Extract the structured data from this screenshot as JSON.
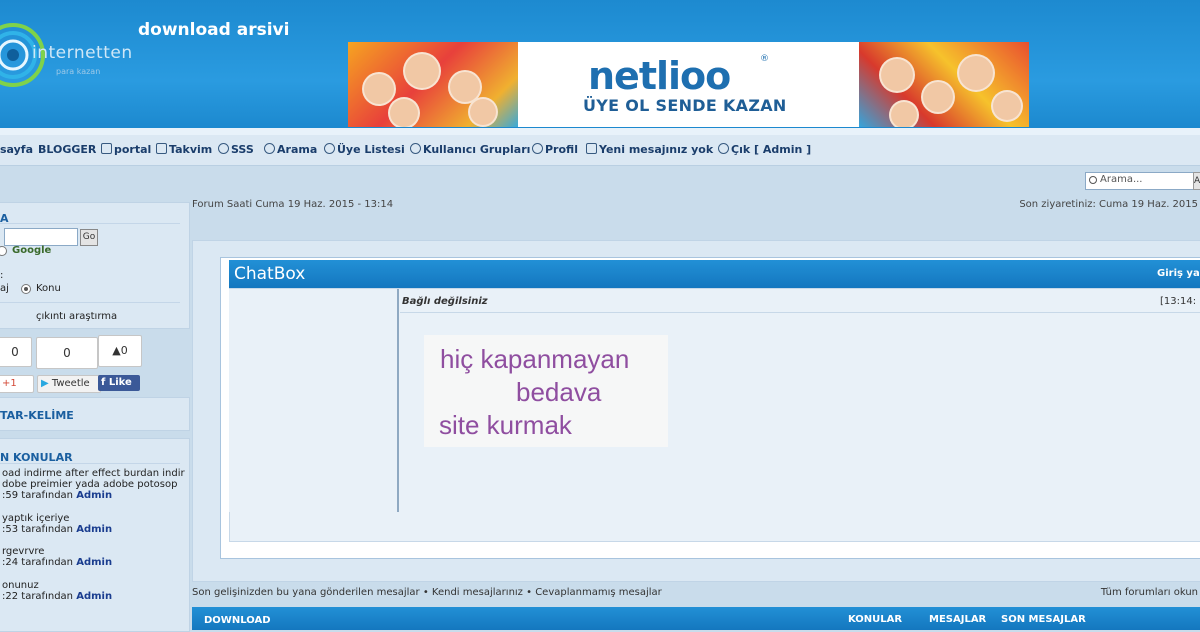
{
  "site": {
    "title": "download arsivi",
    "logo_text": "internetten",
    "logo_sub": "para kazan"
  },
  "banner": {
    "brand": "netlioo",
    "brand_mark": "®",
    "slogan": "ÜYE OL  SENDE KAZAN"
  },
  "nav": {
    "items": [
      {
        "label": "sayfa"
      },
      {
        "label": "BLOGGER"
      },
      {
        "label": "portal"
      },
      {
        "label": "Takvim"
      },
      {
        "label": "SSS"
      },
      {
        "label": "Arama"
      },
      {
        "label": "Üye Listesi"
      },
      {
        "label": "Kullanıcı Grupları"
      },
      {
        "label": "Profil"
      },
      {
        "label": "Yeni mesajınız yok"
      },
      {
        "label": "Çık [ Admin ]"
      }
    ],
    "search_placeholder": "Arama...",
    "search_button": "A"
  },
  "sidebar": {
    "search": {
      "title": "A",
      "go_label": "Go",
      "google_label": "Google",
      "colon_label": ":",
      "option_message": "aj",
      "option_topic": "Konu",
      "footer": "çıkıntı araştırma"
    },
    "share": {
      "gplus_count": "0",
      "tweet_count": "0",
      "like_count": "0",
      "gplus_label": "+1",
      "tweet_label": "Tweetle",
      "like_label": "Like"
    },
    "keywords_title": "TAR-KELİME",
    "recent": {
      "title": "N KONULAR",
      "topics": [
        {
          "line1": "oad indirme after effect burdan indir",
          "line2": "dobe preimier yada adobe potosop",
          "time": ":59 tarafından",
          "author": "Admin"
        },
        {
          "line1": "yaptık içeriye",
          "time": ":53 tarafından",
          "author": "Admin"
        },
        {
          "line1": "rgevrvre",
          "time": ":24 tarafından",
          "author": "Admin"
        },
        {
          "line1": "onunuz",
          "time": ":22 tarafından",
          "author": "Admin"
        }
      ]
    }
  },
  "main": {
    "forum_time": "Forum Saati Cuma 19 Haz. 2015 - 13:14",
    "last_visit": "Son ziyaretiniz: Cuma 19 Haz. 2015",
    "chatbox": {
      "title": "ChatBox",
      "login": "Giriş ya",
      "status": "Bağlı değilsiniz",
      "time": "[13:14:"
    },
    "promo": {
      "line1": "hiç kapanmayan",
      "line2": "bedava",
      "line3": "site kurmak"
    },
    "links": {
      "since_last": "Son gelişinizden bu yana gönderilen mesajlar",
      "own_posts": "Kendi mesajlarınız",
      "unanswered": "Cevaplanmamış mesajlar",
      "all_read": "Tüm forumları okun"
    },
    "table": {
      "category": "DOWNLOAD",
      "col_topics": "KONULAR",
      "col_posts": "MESAJLAR",
      "col_last": "SON MESAJLAR"
    }
  },
  "colors": {
    "header_blue": "#1d8ad0",
    "nav_bg": "#dbe8f3",
    "promo_purple": "#8f4ea0"
  }
}
